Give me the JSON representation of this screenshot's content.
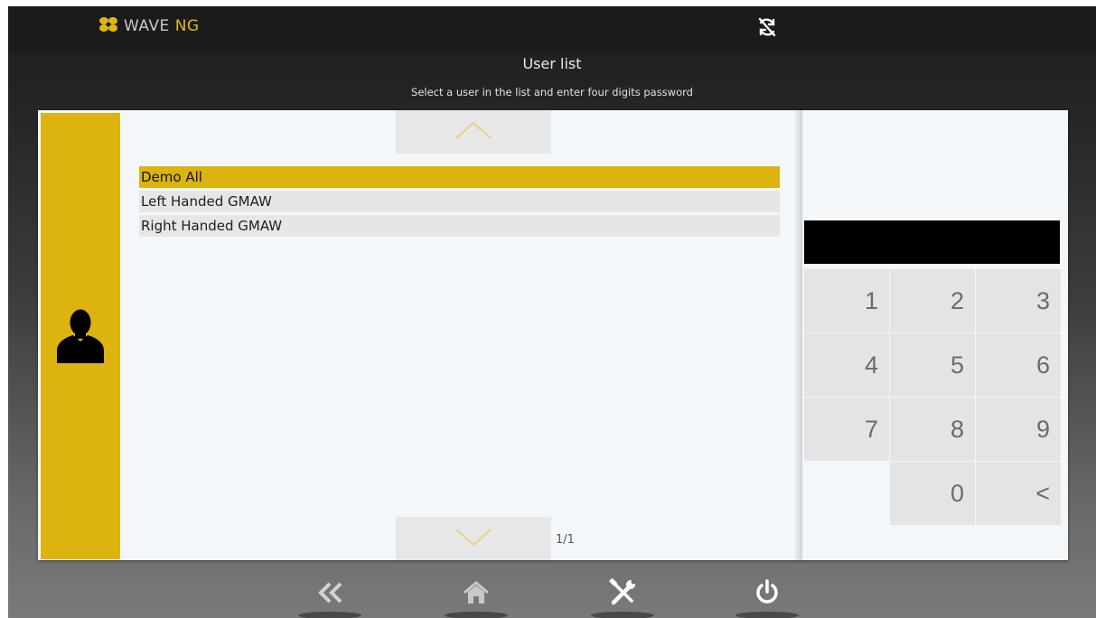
{
  "header": {
    "logo_text": "WAVE ",
    "logo_accent": "NG",
    "logo_icon": "wave-flower-logo-icon",
    "sync_icon": "sync-disabled-icon"
  },
  "page": {
    "title": "User list",
    "subtitle": "Select a user in the list and enter four digits password"
  },
  "sidebar": {
    "icon": "user-silhouette-icon"
  },
  "users": {
    "items": [
      "Demo All",
      "Left Handed GMAW",
      "Right Handed GMAW"
    ],
    "selected_index": 0,
    "page_indicator": "1/1",
    "scroll_up_icon": "chevron-up-icon",
    "scroll_down_icon": "chevron-down-icon"
  },
  "keypad": {
    "display_value": "",
    "keys": [
      "1",
      "2",
      "3",
      "4",
      "5",
      "6",
      "7",
      "8",
      "9",
      "0",
      "<"
    ]
  },
  "bottom_nav": {
    "back_icon": "double-chevron-left-icon",
    "home_icon": "home-icon",
    "tools_icon": "tools-icon",
    "power_icon": "power-icon"
  },
  "colors": {
    "accent": "#dcb30f",
    "panel": "#f4f7fa",
    "key": "#e3e4e5",
    "display": "#000000"
  }
}
